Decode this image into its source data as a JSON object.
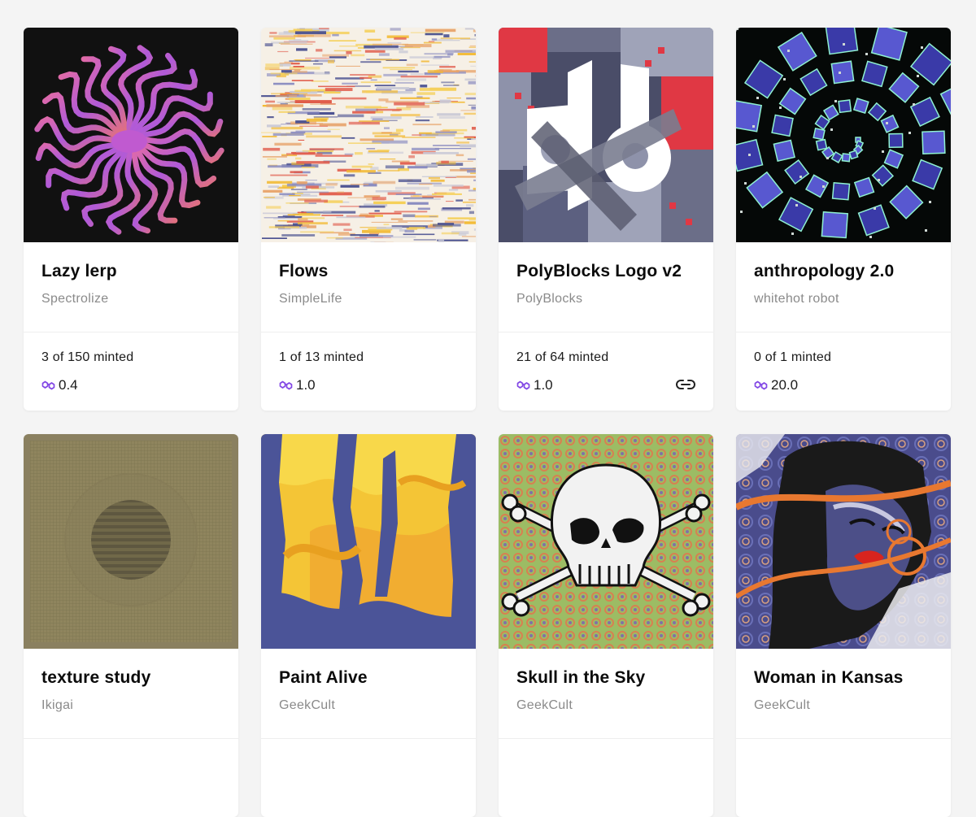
{
  "cards": [
    {
      "title": "Lazy lerp",
      "artist": "Spectrolize",
      "minted": "3 of 150 minted",
      "price": "0.4",
      "art_icon": "lazy-lerp-artwork"
    },
    {
      "title": "Flows",
      "artist": "SimpleLife",
      "minted": "1 of 13 minted",
      "price": "1.0",
      "art_icon": "flows-artwork"
    },
    {
      "title": "PolyBlocks Logo v2",
      "artist": "PolyBlocks",
      "minted": "21 of 64 minted",
      "price": "1.0",
      "art_icon": "polyblocks-artwork",
      "has_link": true
    },
    {
      "title": "anthropology 2.0",
      "artist": "whitehot robot",
      "minted": "0 of 1 minted",
      "price": "20.0",
      "art_icon": "anthropology-artwork"
    },
    {
      "title": "texture study",
      "artist": "Ikigai",
      "art_icon": "texture-study-artwork"
    },
    {
      "title": "Paint Alive",
      "artist": "GeekCult",
      "art_icon": "paint-alive-artwork"
    },
    {
      "title": "Skull in the Sky",
      "artist": "GeekCult",
      "art_icon": "skull-artwork"
    },
    {
      "title": "Woman in Kansas",
      "artist": "GeekCult",
      "art_icon": "woman-portrait-artwork"
    }
  ],
  "colors": {
    "polygon": "#8247e5",
    "background": "#f4f4f4"
  }
}
